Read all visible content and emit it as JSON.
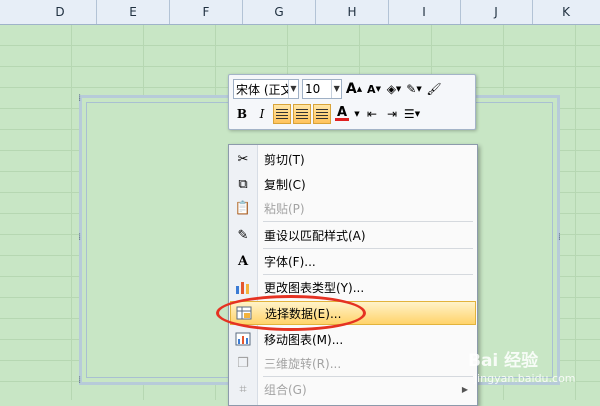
{
  "columns": [
    "D",
    "E",
    "F",
    "G",
    "H",
    "I",
    "J",
    "K"
  ],
  "mini_toolbar": {
    "font_name": "宋体 (正文",
    "font_size": "10",
    "grow_font": "A",
    "shrink_font": "A",
    "bold": "B",
    "italic": "I",
    "font_color_letter": "A"
  },
  "context_menu": {
    "items": [
      {
        "label": "剪切(T)",
        "icon": "scissors-icon",
        "disabled": false
      },
      {
        "label": "复制(C)",
        "icon": "copy-icon",
        "disabled": false
      },
      {
        "label": "粘贴(P)",
        "icon": "paste-icon",
        "disabled": true
      },
      {
        "label": "重设以匹配样式(A)",
        "icon": "reset-style-icon",
        "disabled": false
      },
      {
        "label": "字体(F)...",
        "icon": "font-icon",
        "disabled": false
      },
      {
        "label": "更改图表类型(Y)...",
        "icon": "chart-type-icon",
        "disabled": false
      },
      {
        "label": "选择数据(E)...",
        "icon": "select-data-icon",
        "disabled": false,
        "highlighted": true
      },
      {
        "label": "移动图表(M)...",
        "icon": "move-chart-icon",
        "disabled": false
      },
      {
        "label": "三维旋转(R)...",
        "icon": "3d-rotation-icon",
        "disabled": true
      },
      {
        "label": "组合(G)",
        "icon": "group-icon",
        "disabled": true
      }
    ]
  },
  "watermark": {
    "text": "Bai 经验",
    "url": "jingyan.baidu.com"
  },
  "colors": {
    "sheet_bg": "#c8e6c5",
    "highlight": "#ffd36b",
    "annotation": "#e53222",
    "font_color_bar": "#e02020"
  }
}
